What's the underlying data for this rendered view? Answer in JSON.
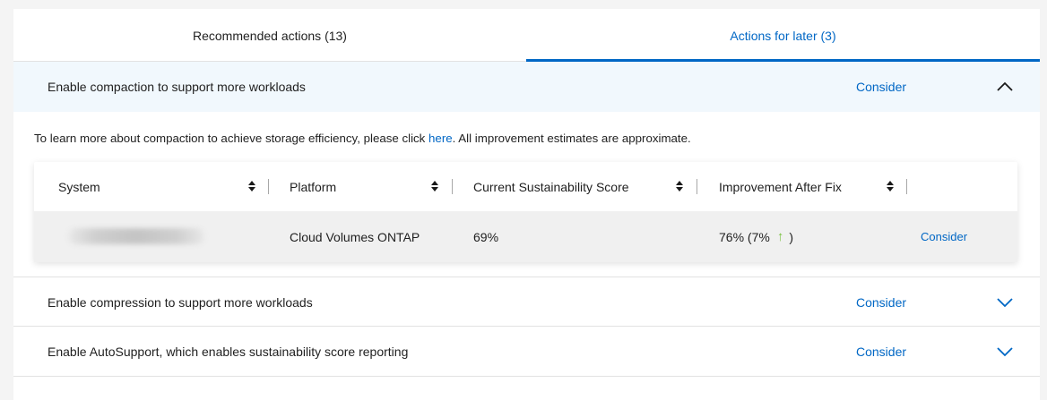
{
  "tabs": [
    {
      "label": "Recommended actions (13)",
      "active": false
    },
    {
      "label": "Actions for later (3)",
      "active": true
    }
  ],
  "colors": {
    "accent": "#0067c5",
    "positive": "#7bc242",
    "expanded_bg": "#f1f8fd"
  },
  "recommendations": [
    {
      "title": "Enable compaction to support more workloads",
      "action": "Consider",
      "expanded": true,
      "chevron": "chevron-up-icon"
    },
    {
      "title": "Enable compression to support more workloads",
      "action": "Consider",
      "expanded": false,
      "chevron": "chevron-down-icon"
    },
    {
      "title": "Enable AutoSupport, which enables sustainability score reporting",
      "action": "Consider",
      "expanded": false,
      "chevron": "chevron-down-icon"
    }
  ],
  "details": {
    "info_prefix": "To learn more about compaction to achieve storage efficiency, please click ",
    "info_link": "here",
    "info_suffix": ". All improvement estimates are approximate.",
    "columns": [
      "System",
      "Platform",
      "Current Sustainability Score",
      "Improvement After Fix"
    ],
    "rows": [
      {
        "system": "",
        "platform": "Cloud Volumes ONTAP",
        "current_score": "69%",
        "improvement_prefix": "76% (7%",
        "improvement_icon": "arrow-up-icon",
        "improvement_suffix": ")",
        "action": "Consider"
      }
    ]
  }
}
